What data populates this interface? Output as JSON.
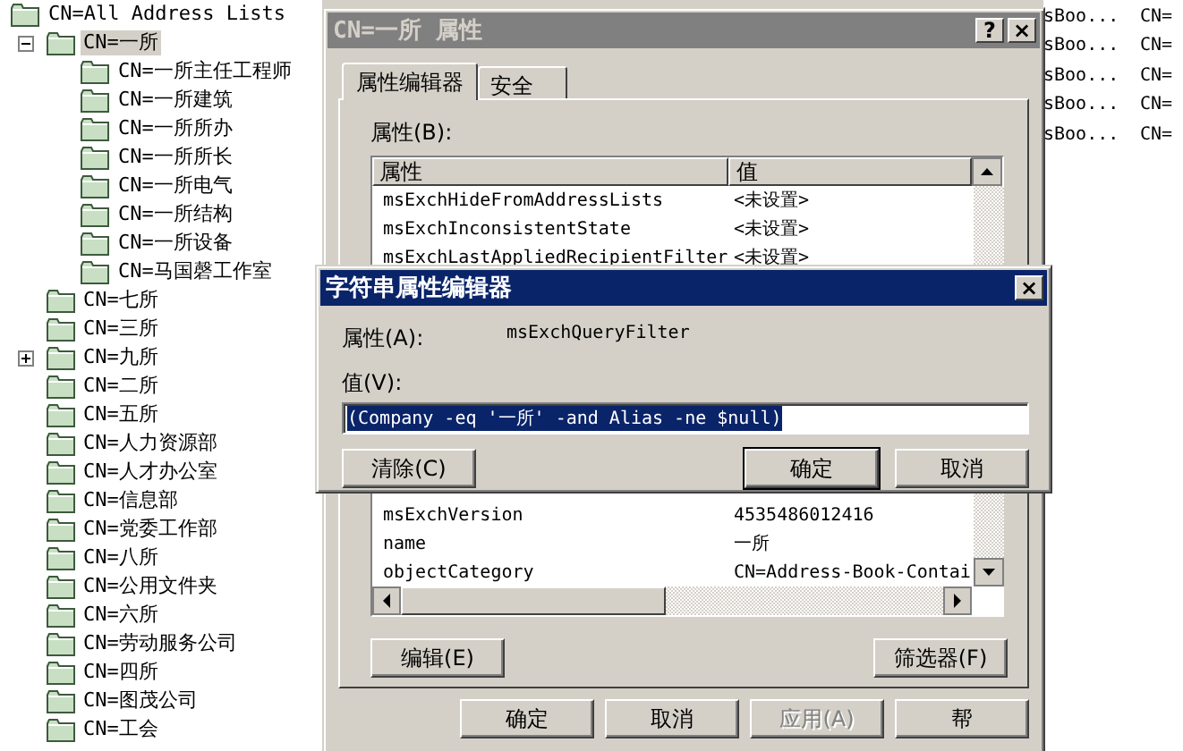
{
  "tree": {
    "items": [
      {
        "label": "CN=All Address Lists",
        "selected": false,
        "children": [
          {
            "label": "CN=一所",
            "expanded": true,
            "selected": true,
            "children": [
              {
                "label": "CN=一所主任工程师",
                "selected": false
              },
              {
                "label": "CN=一所建筑",
                "selected": false
              },
              {
                "label": "CN=一所所办",
                "selected": false
              },
              {
                "label": "CN=一所所长",
                "selected": false
              },
              {
                "label": "CN=一所电气",
                "selected": false
              },
              {
                "label": "CN=一所结构",
                "selected": false
              },
              {
                "label": "CN=一所设备",
                "selected": false
              },
              {
                "label": "CN=马国磬工作室",
                "selected": false
              }
            ]
          },
          {
            "label": "CN=七所",
            "selected": false
          },
          {
            "label": "CN=三所",
            "selected": false
          },
          {
            "label": "CN=九所",
            "expanded": false,
            "selected": false
          },
          {
            "label": "CN=二所",
            "selected": false
          },
          {
            "label": "CN=五所",
            "selected": false
          },
          {
            "label": "CN=人力资源部",
            "selected": false
          },
          {
            "label": "CN=人才办公室",
            "selected": false
          },
          {
            "label": "CN=信息部",
            "selected": false
          },
          {
            "label": "CN=党委工作部",
            "selected": false
          },
          {
            "label": "CN=八所",
            "selected": false
          },
          {
            "label": "CN=公用文件夹",
            "selected": false
          },
          {
            "label": "CN=六所",
            "selected": false
          },
          {
            "label": "CN=劳动服务公司",
            "selected": false
          },
          {
            "label": "CN=四所",
            "selected": false
          },
          {
            "label": "CN=图茂公司",
            "selected": false
          },
          {
            "label": "CN=工会",
            "selected": false
          }
        ]
      }
    ]
  },
  "right_list": {
    "rows": [
      {
        "column_1": "sBoo...",
        "column_2": "CN="
      },
      {
        "column_1": "sBoo...",
        "column_2": "CN="
      },
      {
        "column_1": "sBoo...",
        "column_2": "CN="
      },
      {
        "column_1": "sBoo...",
        "column_2": "CN="
      },
      {
        "column_1": "sBoo...",
        "column_2": "CN="
      }
    ]
  },
  "properties_dialog": {
    "title": "CN=一所 属性",
    "active": false,
    "help_button": "?",
    "close_button": "×",
    "tabs": [
      {
        "label": "属性编辑器",
        "selected": true
      },
      {
        "label": "安全",
        "selected": false
      }
    ],
    "list_label": "属性(B):",
    "table": {
      "columns": [
        "属性",
        "值"
      ],
      "rows_above_dialog": [
        {
          "attribute": "msExchHideFromAddressLists",
          "value": "<未设置>"
        },
        {
          "attribute": "msExchInconsistentState",
          "value": "<未设置>"
        },
        {
          "attribute": "msExchLastAppliedRecipientFilter",
          "value": "<未设置>"
        }
      ],
      "rows_below_dialog": [
        {
          "attribute": "msExchVersion",
          "value": "4535486012416"
        },
        {
          "attribute": "name",
          "value": "一所"
        },
        {
          "attribute": "objectCategory",
          "value": "CN=Address-Book-Contai"
        }
      ]
    },
    "edit_button": "编辑(E)",
    "filter_button": "筛选器(F)",
    "buttons": [
      {
        "label": "确定",
        "disabled": false
      },
      {
        "label": "取消",
        "disabled": false
      },
      {
        "label": "应用(A)",
        "disabled": true
      },
      {
        "label": "帮",
        "disabled": false
      }
    ]
  },
  "string_editor": {
    "title": "字符串属性编辑器",
    "active": true,
    "close_button": "×",
    "attribute_label": "属性(A):",
    "attribute": "msExchQueryFilter",
    "value_label": "值(V):",
    "value": "(Company -eq '一所' -and Alias -ne $null)",
    "value_selected": true,
    "buttons": [
      {
        "label": "清除(C)",
        "default": false
      },
      {
        "label": "确定",
        "default": true
      },
      {
        "label": "取消",
        "default": false
      }
    ]
  }
}
